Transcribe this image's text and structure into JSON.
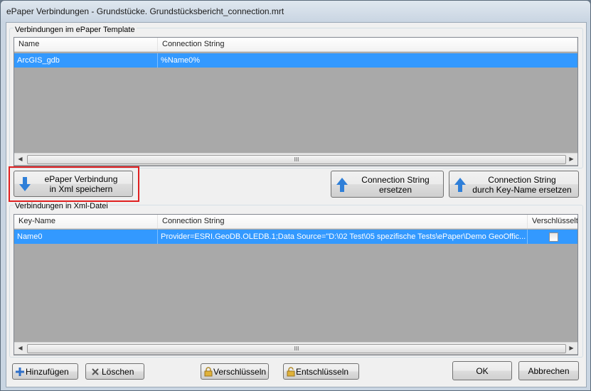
{
  "window": {
    "title": "ePaper Verbindungen - Grundstücke. Grundstücksbericht_connection.mrt"
  },
  "template_group": {
    "label": "Verbindungen im ePaper Template",
    "columns": [
      "Name",
      "Connection String"
    ],
    "rows": [
      {
        "name": "ArcGIS_gdb",
        "connection": "%Name0%"
      }
    ]
  },
  "xml_group": {
    "label": "Verbindungen in Xml-Datei",
    "columns": [
      "Key-Name",
      "Connection String",
      "Verschlüsselt"
    ],
    "rows": [
      {
        "key": "Name0",
        "connection": "Provider=ESRI.GeoDB.OLEDB.1;Data Source=\"D:\\02 Test\\05 spezifische Tests\\ePaper\\Demo GeoOffic...",
        "encrypted": false
      }
    ]
  },
  "buttons": {
    "save_xml": [
      "ePaper Verbindung",
      "in Xml speichern"
    ],
    "replace": [
      "Connection String",
      "ersetzen"
    ],
    "replace_key": [
      "Connection String",
      "durch Key-Name ersetzen"
    ],
    "add": "Hinzufügen",
    "delete": "Löschen",
    "encrypt": "Verschlüsseln",
    "decrypt": "Entschlüsseln",
    "ok": "OK",
    "cancel": "Abbrechen"
  },
  "scroll_thumb": "III",
  "colors": {
    "selection": "#3399ff",
    "grid_bg": "#a9a9a9",
    "highlight": "#e02020"
  }
}
